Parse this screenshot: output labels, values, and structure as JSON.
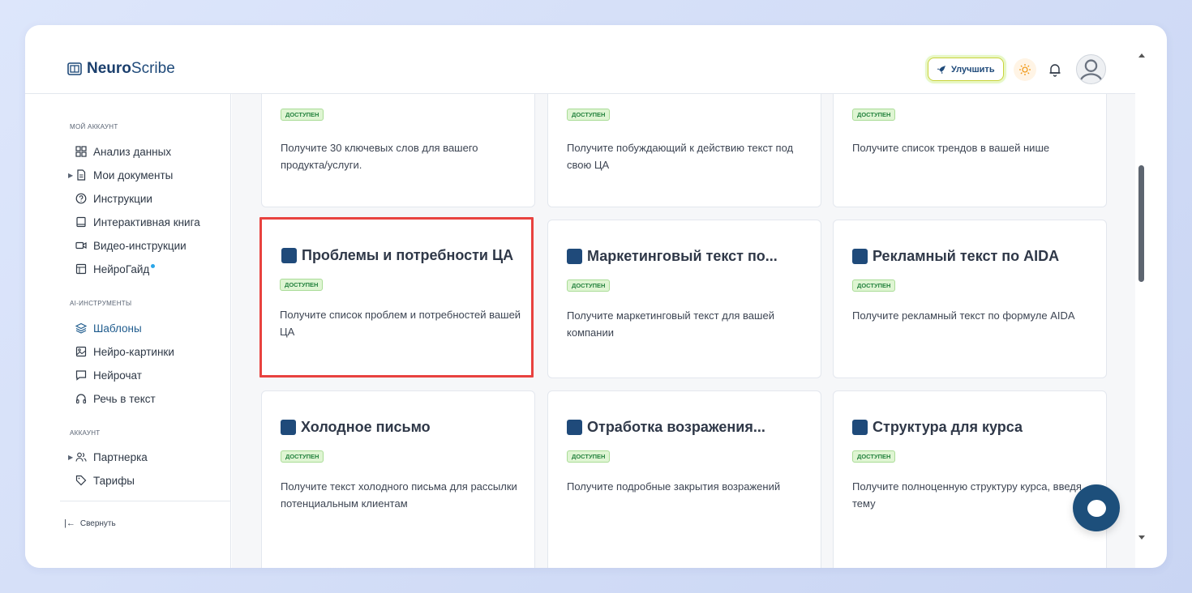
{
  "header": {
    "logo_bold": "Neuro",
    "logo_rest": "Scribe",
    "upgrade_label": "Улучшить"
  },
  "sidebar": {
    "section_account": "МОЙ АККАУНТ",
    "section_tools": "AI-ИНСТРУМЕНТЫ",
    "section_billing": "АККАУНТ",
    "items": [
      {
        "label": "Анализ данных",
        "icon": "grid-icon"
      },
      {
        "label": "Мои документы",
        "icon": "document-icon"
      },
      {
        "label": "Инструкции",
        "icon": "help-circle-icon"
      },
      {
        "label": "Интерактивная книга",
        "icon": "book-icon"
      },
      {
        "label": "Видео-инструкции",
        "icon": "video-icon"
      },
      {
        "label": "НейроГайд",
        "icon": "guide-icon"
      },
      {
        "label": "Шаблоны",
        "icon": "layers-icon"
      },
      {
        "label": "Нейро-картинки",
        "icon": "image-icon"
      },
      {
        "label": "Нейрочат",
        "icon": "chat-icon"
      },
      {
        "label": "Речь в текст",
        "icon": "headphones-icon"
      },
      {
        "label": "Партнерка",
        "icon": "users-icon"
      },
      {
        "label": "Тарифы",
        "icon": "tag-icon"
      }
    ],
    "collapse_label": "Свернуть"
  },
  "cards": [
    {
      "title": "",
      "badge": "ДОСТУПЕН",
      "desc": "Получите 30 ключевых слов для вашего продукта/услуги."
    },
    {
      "title": "",
      "badge": "ДОСТУПЕН",
      "desc": "Получите побуждающий к действию текст под свою ЦА"
    },
    {
      "title": "",
      "badge": "ДОСТУПЕН",
      "desc": "Получите список трендов в вашей нише"
    },
    {
      "title": "Проблемы и потребности ЦА",
      "badge": "ДОСТУПЕН",
      "desc": "Получите список проблем и потребностей вашей ЦА"
    },
    {
      "title": "Маркетинговый текст по...",
      "badge": "ДОСТУПЕН",
      "desc": "Получите маркетинговый текст для вашей компании"
    },
    {
      "title": "Рекламный текст по AIDA",
      "badge": "ДОСТУПЕН",
      "desc": "Получите рекламный текст по формуле AIDA"
    },
    {
      "title": "Холодное письмо",
      "badge": "ДОСТУПЕН",
      "desc": "Получите текст холодного письма для рассылки потенциальным клиентам"
    },
    {
      "title": "Отработка возражения...",
      "badge": "ДОСТУПЕН",
      "desc": "Получите подробные закрытия возражений"
    },
    {
      "title": "Структура для курса",
      "badge": "ДОСТУПЕН",
      "desc": "Получите полноценную структуру курса, введя тему"
    }
  ],
  "colors": {
    "brand": "#1f4a7a",
    "highlight": "#e8423f",
    "badge_bg": "#dff5d3",
    "badge_text": "#24823e"
  }
}
